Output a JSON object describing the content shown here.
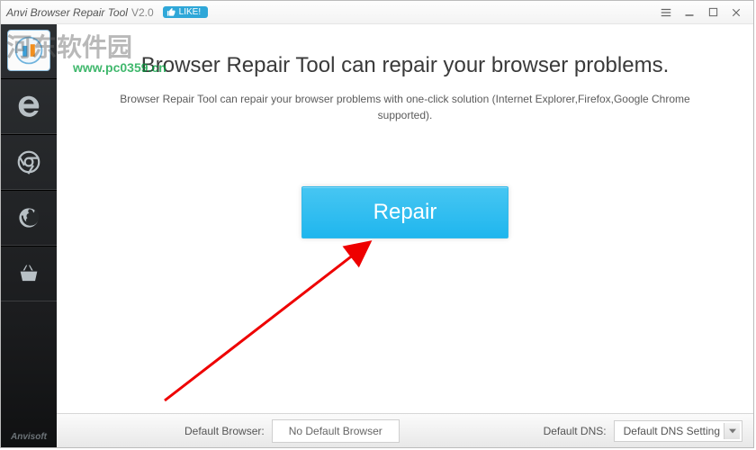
{
  "titlebar": {
    "app_name": "Anvi Browser Repair Tool",
    "version": "V2.0",
    "like_label": "LIKE!"
  },
  "sidebar": {
    "brand": "Anvisoft"
  },
  "main": {
    "headline": "Browser Repair Tool can repair your browser problems.",
    "subline": "Browser Repair Tool can repair your browser problems with one-click solution (Internet Explorer,Firefox,Google Chrome supported).",
    "repair_label": "Repair"
  },
  "bottombar": {
    "default_browser_label": "Default Browser:",
    "default_browser_value": "No Default Browser",
    "default_dns_label": "Default DNS:",
    "default_dns_value": "Default DNS Setting"
  },
  "watermark": {
    "text": "河东软件园",
    "url": "www.pc0359.cn"
  }
}
